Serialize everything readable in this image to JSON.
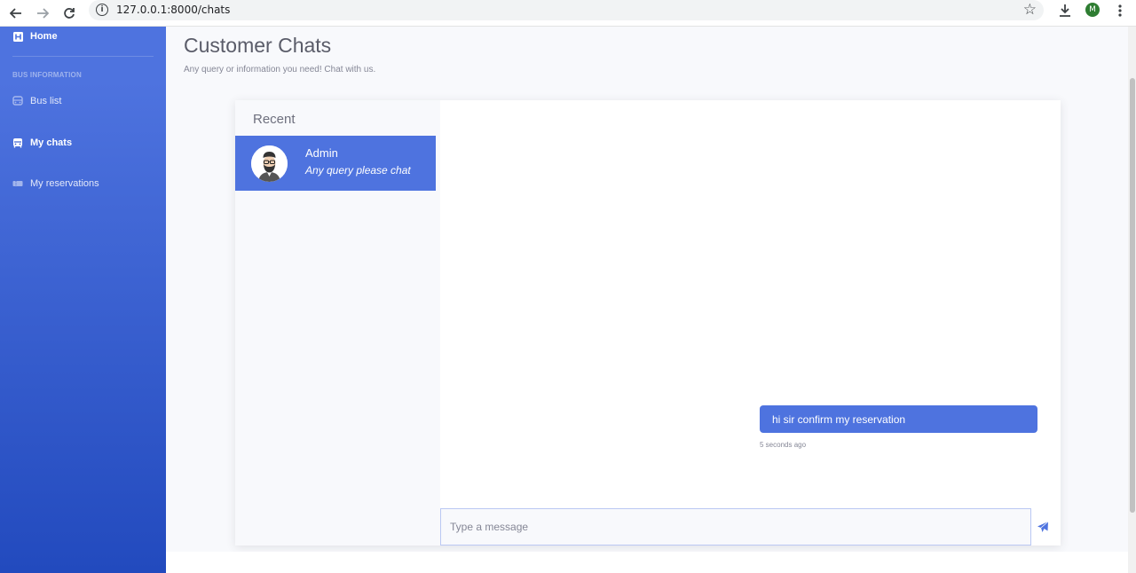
{
  "browser": {
    "url": "127.0.0.1:8000/chats",
    "profile_initial": "M"
  },
  "sidebar": {
    "brand_label": "Home",
    "heading": "BUS INFORMATION",
    "items": [
      {
        "label": "Bus list"
      },
      {
        "label": "My chats"
      },
      {
        "label": "My reservations"
      }
    ]
  },
  "header": {
    "title": "Customer Chats",
    "subtitle": "Any query or information you need! Chat with us."
  },
  "inbox": {
    "title": "Recent",
    "chats": [
      {
        "name": "Admin",
        "snippet": "Any query please chat"
      }
    ]
  },
  "messages": [
    {
      "text": "hi sir confirm my reservation",
      "time": "5 seconds ago"
    }
  ],
  "composer": {
    "placeholder": "Type a message"
  },
  "colors": {
    "primary": "#4e73df",
    "sidebar_end": "#224abe"
  }
}
